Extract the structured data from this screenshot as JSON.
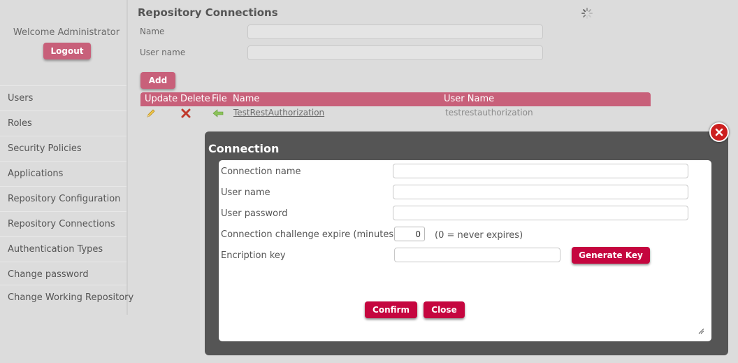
{
  "sidebar": {
    "welcome": "Welcome Administrator",
    "logout_label": "Logout",
    "items": [
      {
        "label": "Users"
      },
      {
        "label": "Roles"
      },
      {
        "label": "Security Policies"
      },
      {
        "label": "Applications"
      },
      {
        "label": "Repository Configuration"
      },
      {
        "label": "Repository Connections"
      },
      {
        "label": "Authentication Types"
      },
      {
        "label": "Change password"
      },
      {
        "label": "Change Working Repository"
      }
    ]
  },
  "main": {
    "title": "Repository Connections",
    "filters": {
      "name_label": "Name",
      "name_value": "",
      "username_label": "User name",
      "username_value": ""
    },
    "add_label": "Add",
    "table": {
      "columns": [
        "Update",
        "Delete",
        "File",
        "Name",
        "User Name"
      ],
      "rows": [
        {
          "name": "TestRestAuthorization",
          "user_name": "testrestauthorization"
        }
      ]
    }
  },
  "modal": {
    "title": "Connection",
    "fields": {
      "connection_name_label": "Connection name",
      "connection_name_value": "",
      "user_name_label": "User name",
      "user_name_value": "",
      "user_password_label": "User password",
      "user_password_value": "",
      "expire_label": "Connection challenge expire (minutes)",
      "expire_value": "0",
      "expire_hint": "(0 = never expires)",
      "encryption_key_label": "Encription key",
      "encryption_key_value": ""
    },
    "generate_key_label": "Generate Key",
    "confirm_label": "Confirm",
    "close_label": "Close"
  },
  "icons": {
    "update": "pencil-icon",
    "delete": "x-icon",
    "file": "arrow-left-icon",
    "modal_close": "close-icon",
    "loading": "spinner-icon"
  },
  "colors": {
    "accent": "#c8607a",
    "primary_button": "#c5063f",
    "modal_frame": "#555555",
    "close_red": "#cc1f1f"
  }
}
